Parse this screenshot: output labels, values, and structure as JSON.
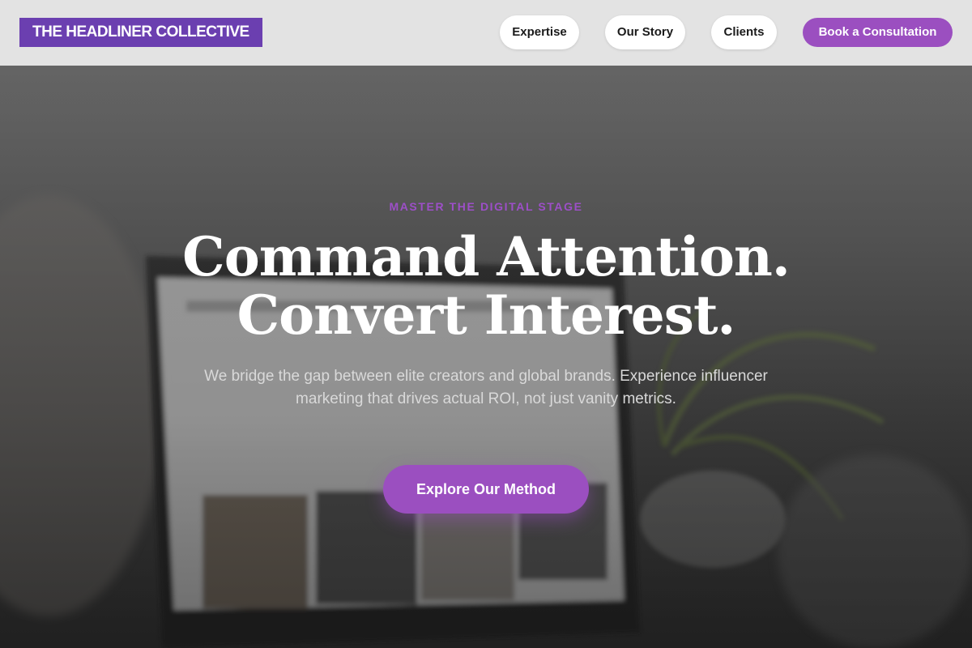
{
  "header": {
    "logo_text": "THE HEADLINER COLLECTIVE",
    "nav": [
      {
        "label": "Expertise"
      },
      {
        "label": "Our Story"
      },
      {
        "label": "Clients"
      }
    ],
    "cta_label": "Book a Consultation"
  },
  "hero": {
    "eyebrow": "MASTER THE DIGITAL STAGE",
    "headline_line1": "Command Attention.",
    "headline_line2": "Convert Interest.",
    "subhead": "We bridge the gap between elite creators and global brands. Experience influencer marketing that drives actual ROI, not just vanity metrics.",
    "cta_label": "Explore Our Method",
    "background_image": "laptop-and-plant-photo"
  },
  "colors": {
    "brand_purple": "#6b3fb0",
    "accent_purple": "#9b4fc0",
    "header_bg": "#e3e3e3"
  }
}
